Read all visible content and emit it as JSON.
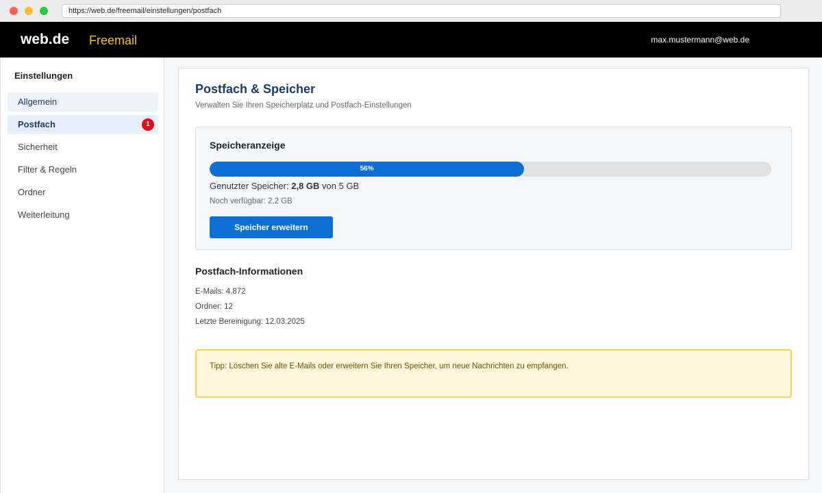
{
  "browser": {
    "url": "https://web.de/freemail/einstellungen/postfach"
  },
  "header": {
    "brand": "web.de",
    "product": "Freemail",
    "user_email": "max.mustermann@web.de"
  },
  "sidebar": {
    "title": "Einstellungen",
    "items": [
      {
        "label": "Allgemein",
        "state": "hover"
      },
      {
        "label": "Postfach",
        "state": "active",
        "badge": "1"
      },
      {
        "label": "Sicherheit"
      },
      {
        "label": "Filter & Regeln"
      },
      {
        "label": "Ordner"
      },
      {
        "label": "Weiterleitung"
      }
    ]
  },
  "main": {
    "title": "Postfach & Speicher",
    "subtitle": "Verwalten Sie Ihren Speicherplatz und Postfach-Einstellungen",
    "storage": {
      "title": "Speicheranzeige",
      "percent_used": 56,
      "percent_label": "56%",
      "used_prefix": "Genutzter Speicher: ",
      "used_value": "2,8 GB",
      "used_suffix": " von 5 GB",
      "remaining": "Noch verfügbar: 2,2 GB",
      "button_label": "Speicher erweitern"
    },
    "info": {
      "title": "Postfach-Informationen",
      "rows": [
        "E-Mails: 4.872",
        "Ordner: 12",
        "Letzte Bereinigung: 12.03.2025"
      ]
    },
    "tip": "Tipp: Löschen Sie alte E-Mails oder erweitern Sie Ihren Speicher, um neue Nachrichten zu empfangen."
  },
  "colors": {
    "accent": "#0d6fd1",
    "header_bg": "#000000",
    "brand_yellow": "#f5c518",
    "badge_red": "#e30613",
    "tip_border": "#f7d155",
    "tip_bg": "#fff8dc"
  }
}
